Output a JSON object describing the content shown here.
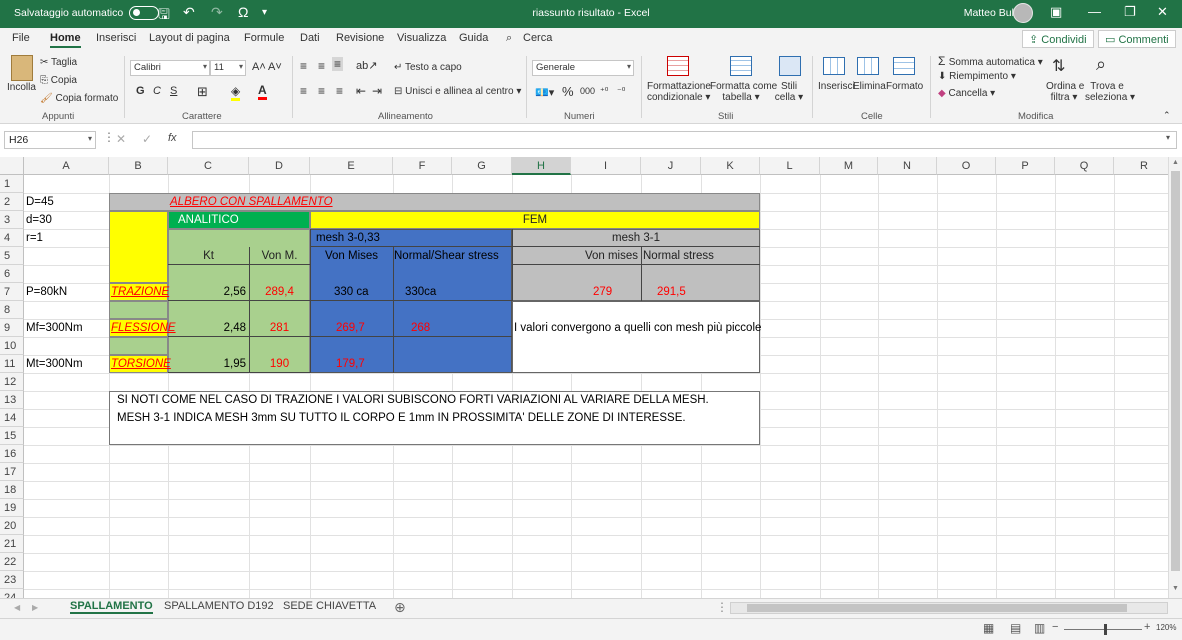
{
  "titlebar": {
    "autosave_label": "Salvataggio automatico",
    "document_title": "riassunto risultato  -  Excel",
    "user": "Matteo Bulfaro"
  },
  "tabs": [
    "File",
    "Home",
    "Inserisci",
    "Layout di pagina",
    "Formule",
    "Dati",
    "Revisione",
    "Visualizza",
    "Guida"
  ],
  "search_label": "Cerca",
  "share_label": "Condividi",
  "comments_label": "Commenti",
  "ribbon": {
    "paste": "Incolla",
    "cut": "Taglia",
    "copy": "Copia",
    "format_painter": "Copia formato",
    "clipboard_group": "Appunti",
    "font_name": "Calibri",
    "font_size": "11",
    "font_grow": "A˄",
    "font_shrink": "A˅",
    "bold": "G",
    "italic": "C",
    "underline": "S",
    "font_group": "Carattere",
    "wrap_text": "Testo a capo",
    "merge_center": "Unisci e allinea al centro",
    "alignment_group": "Allineamento",
    "number_format": "Generale",
    "percent": "%",
    "thousands": "000",
    "number_group": "Numeri",
    "cond_format_1": "Formattazione",
    "cond_format_2": "condizionale",
    "format_table_1": "Formatta come",
    "format_table_2": "tabella",
    "cell_styles_1": "Stili",
    "cell_styles_2": "cella",
    "styles_group": "Stili",
    "insert": "Inserisci",
    "delete": "Elimina",
    "format": "Formato",
    "cells_group": "Celle",
    "autosum": "Somma automatica",
    "fill": "Riempimento",
    "clear": "Cancella",
    "sort_1": "Ordina e",
    "sort_2": "filtra",
    "find_1": "Trova e",
    "find_2": "seleziona",
    "editing_group": "Modifica"
  },
  "formula_bar": {
    "name_box": "H26",
    "fx": "fx"
  },
  "columns": [
    "A",
    "B",
    "C",
    "D",
    "E",
    "F",
    "G",
    "H",
    "I",
    "J",
    "K",
    "L",
    "M",
    "N",
    "O",
    "P",
    "Q",
    "R"
  ],
  "selected_column": "H",
  "rows": [
    "1",
    "2",
    "3",
    "4",
    "5",
    "6",
    "7",
    "8",
    "9",
    "10",
    "11",
    "12",
    "13",
    "14",
    "15",
    "16",
    "17",
    "18",
    "19",
    "20",
    "21",
    "22",
    "23",
    "24"
  ],
  "cells": {
    "A2": "D=45",
    "A3": "d=30",
    "A4": "r=1",
    "A7": "P=80kN",
    "A9": "Mf=300Nm",
    "A11": "Mt=300Nm",
    "C2": "ALBERO CON SPALLAMENTO",
    "C3": "ANALITICO",
    "F3": "FEM",
    "E4": "mesh 3-0,33",
    "I4": "mesh 3-1",
    "C5": "Kt",
    "D5": "Von M.",
    "E5": "Von Mises",
    "F5": "Normal/Shear stress",
    "I5": "Von mises",
    "J5": "Normal stress",
    "B7": "TRAZIONE",
    "C7": "2,56",
    "D7": "289,4",
    "E7": "330 ca",
    "F7": "330ca",
    "I7": "279",
    "J7": "291,5",
    "B9": "FLESSIONE",
    "C9": "2,48",
    "D9": "281",
    "E9": "269,7",
    "F9": "268",
    "H9": "I valori convergono a quelli con mesh più piccole",
    "B11": "TORSIONE",
    "C11": "1,95",
    "D11": "190",
    "E11": "179,7",
    "B13": "SI NOTI COME NEL CASO DI TRAZIONE I VALORI SUBISCONO FORTI VARIAZIONI AL VARIARE DELLA MESH.",
    "B14": "MESH 3-1 INDICA MESH 3mm SU TUTTO IL CORPO E 1mm IN PROSSIMITA' DELLE ZONE DI INTERESSE."
  },
  "sheets": [
    "SPALLAMENTO",
    "SPALLAMENTO D192",
    "SEDE CHIAVETTA"
  ],
  "active_sheet": "SPALLAMENTO",
  "zoom": "120%",
  "colors": {
    "excel_green": "#217346",
    "header_gray": "#bfbfbf",
    "yellow": "#ffff00",
    "green_fill": "#a9d08e",
    "bright_green": "#00b050",
    "blue": "#4472c4",
    "red_text": "#ff0000"
  }
}
